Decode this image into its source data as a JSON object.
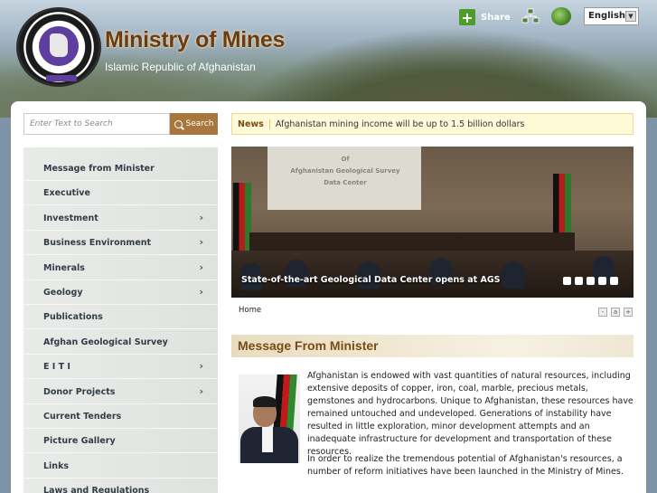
{
  "header": {
    "title": "Ministry of Mines",
    "subtitle": "Islamic Republic of Afghanistan",
    "share_label": "Share",
    "language": "English"
  },
  "search": {
    "placeholder": "Enter Text to Search",
    "button_label": "Search"
  },
  "news": {
    "label": "News",
    "headline": "Afghanistan mining income will be up to 1.5 billion dollars"
  },
  "sidebar": {
    "items": [
      {
        "label": "Message from Minister",
        "has_submenu": false
      },
      {
        "label": "Executive",
        "has_submenu": false
      },
      {
        "label": "Investment",
        "has_submenu": true
      },
      {
        "label": "Business Environment",
        "has_submenu": true
      },
      {
        "label": "Minerals",
        "has_submenu": true
      },
      {
        "label": "Geology",
        "has_submenu": true
      },
      {
        "label": "Publications",
        "has_submenu": false
      },
      {
        "label": "Afghan Geological Survey",
        "has_submenu": false
      },
      {
        "label": "E I T I",
        "has_submenu": true
      },
      {
        "label": "Donor Projects",
        "has_submenu": true
      },
      {
        "label": "Current Tenders",
        "has_submenu": false
      },
      {
        "label": "Picture Gallery",
        "has_submenu": false
      },
      {
        "label": "Links",
        "has_submenu": false
      },
      {
        "label": "Laws and Regulations",
        "has_submenu": false
      }
    ],
    "chevron": "›"
  },
  "slideshow": {
    "caption": "State-of-the-art Geological Data Center opens at AGS",
    "screen_line1": "Of",
    "screen_line2": "Afghanistan Geological Survey",
    "screen_line3": "Data Center",
    "dot_count": 5
  },
  "breadcrumb": "Home",
  "text_size": {
    "decrease": "-",
    "reset": "a",
    "increase": "+"
  },
  "content": {
    "heading": "Message From Minister",
    "paragraph1": "Afghanistan is endowed with vast quantities of natural resources, including extensive deposits of copper, iron, coal, marble, precious metals, gemstones and hydrocarbons. Unique to Afghanistan, these resources have remained untouched and undeveloped.  Generations of instability have resulted in little exploration, minor development attempts and an inadequate infrastructure for development and transportation of these resources.",
    "paragraph2": "In order to realize the tremendous potential of Afghanistan's resources, a number of reform initiatives have been launched in the Ministry of Mines."
  },
  "colors": {
    "accent_brown": "#a8773e",
    "title_brown": "#7a4b14",
    "share_green": "#4e9c2a"
  }
}
